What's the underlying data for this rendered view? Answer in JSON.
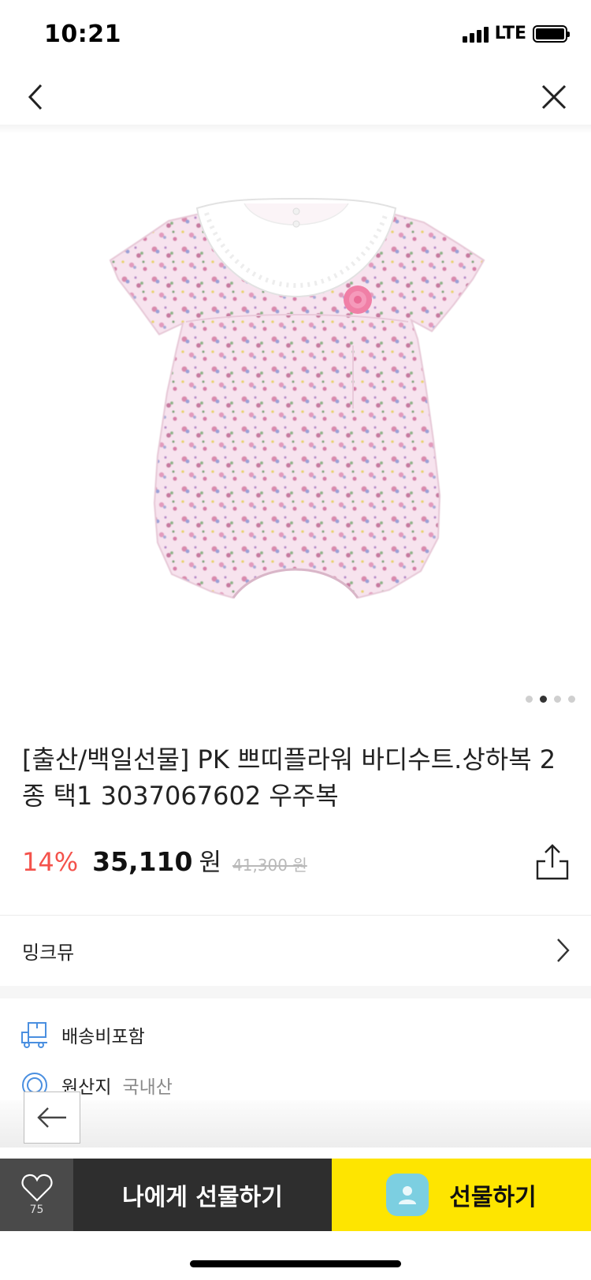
{
  "status_bar": {
    "time": "10:21",
    "network": "LTE"
  },
  "nav": {
    "back_icon": "chevron-left-icon",
    "close_icon": "close-icon"
  },
  "gallery": {
    "image_count": 4,
    "active_index": 1
  },
  "product": {
    "title": "[출산/백일선물] PK 쁘띠플라워 바디수트.상하복 2종 택1 3037067602 우주복",
    "discount": "14%",
    "price": "35,110",
    "price_unit": "원",
    "original_price": "41,300 원"
  },
  "brand": {
    "name": "밍크뮤"
  },
  "info": {
    "shipping_label": "배송비포함",
    "origin_label": "원산지",
    "origin_value": "국내산"
  },
  "bottom_bar": {
    "wish_count": "75",
    "self_gift_label": "나에게 선물하기",
    "gift_label": "선물하기"
  },
  "colors": {
    "discount": "#f4524b",
    "gift_button": "#fee500",
    "self_gift_button": "#2e2e2e",
    "accent_icon": "#4a8fe0"
  }
}
